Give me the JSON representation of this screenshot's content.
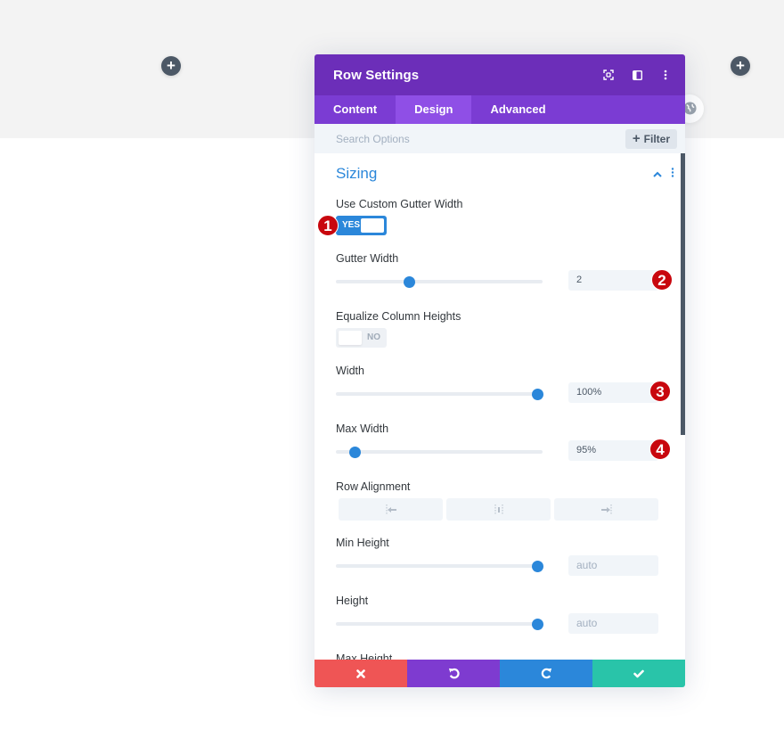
{
  "canvas": {
    "add_row_buttons": [
      "+",
      "+"
    ]
  },
  "modal": {
    "title": "Row Settings",
    "header_icons": [
      "fullscreen-icon",
      "sidebar-layout-icon",
      "more-options-icon"
    ],
    "tabs": [
      {
        "label": "Content",
        "active": false
      },
      {
        "label": "Design",
        "active": true
      },
      {
        "label": "Advanced",
        "active": false
      }
    ],
    "search": {
      "placeholder": "Search Options",
      "value": ""
    },
    "filter_label": "Filter",
    "section": {
      "title": "Sizing",
      "expanded": true
    },
    "fields": {
      "custom_gutter": {
        "label": "Use Custom Gutter Width",
        "state": "YES",
        "on": true
      },
      "gutter_width": {
        "label": "Gutter Width",
        "value": "2",
        "slider_fraction": 0.34
      },
      "equalize": {
        "label": "Equalize Column Heights",
        "state": "NO",
        "on": false
      },
      "width": {
        "label": "Width",
        "value": "100%",
        "slider_fraction": 1.0
      },
      "max_width": {
        "label": "Max Width",
        "value": "95%",
        "slider_fraction": 0.06
      },
      "row_alignment": {
        "label": "Row Alignment",
        "options": [
          "left",
          "center",
          "right"
        ]
      },
      "min_height": {
        "label": "Min Height",
        "placeholder": "auto",
        "slider_fraction": 1.0
      },
      "height": {
        "label": "Height",
        "placeholder": "auto",
        "slider_fraction": 1.0
      },
      "max_height": {
        "label": "Max Height"
      }
    },
    "annotations": [
      "1",
      "2",
      "3",
      "4"
    ],
    "footer": {
      "cancel": "cancel-icon",
      "undo": "undo-icon",
      "redo": "redo-icon",
      "save": "save-icon"
    }
  },
  "colors": {
    "header": "#6c2eb9",
    "tabs": "#7b3cd3",
    "active_tab": "#8f4fe6",
    "accent": "#2b87da",
    "cancel": "#ef5555",
    "undo": "#7e3bd0",
    "redo": "#2b87da",
    "save": "#29c4a9",
    "badge": "#c8070e"
  }
}
